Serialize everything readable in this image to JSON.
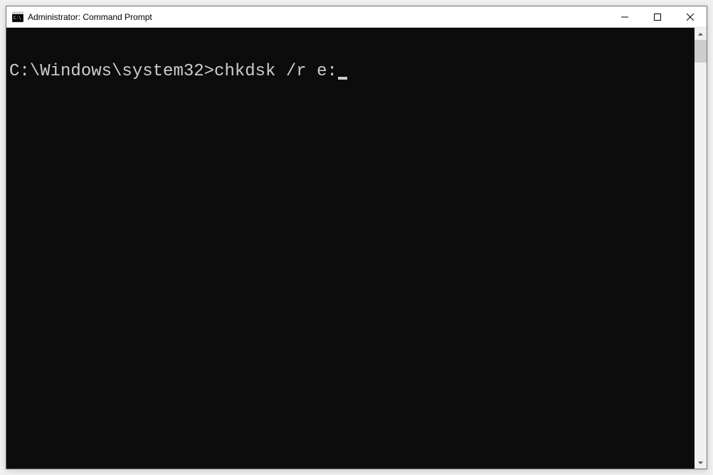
{
  "window": {
    "title": "Administrator: Command Prompt"
  },
  "terminal": {
    "prompt": "C:\\Windows\\system32>",
    "command": "chkdsk /r e:"
  }
}
